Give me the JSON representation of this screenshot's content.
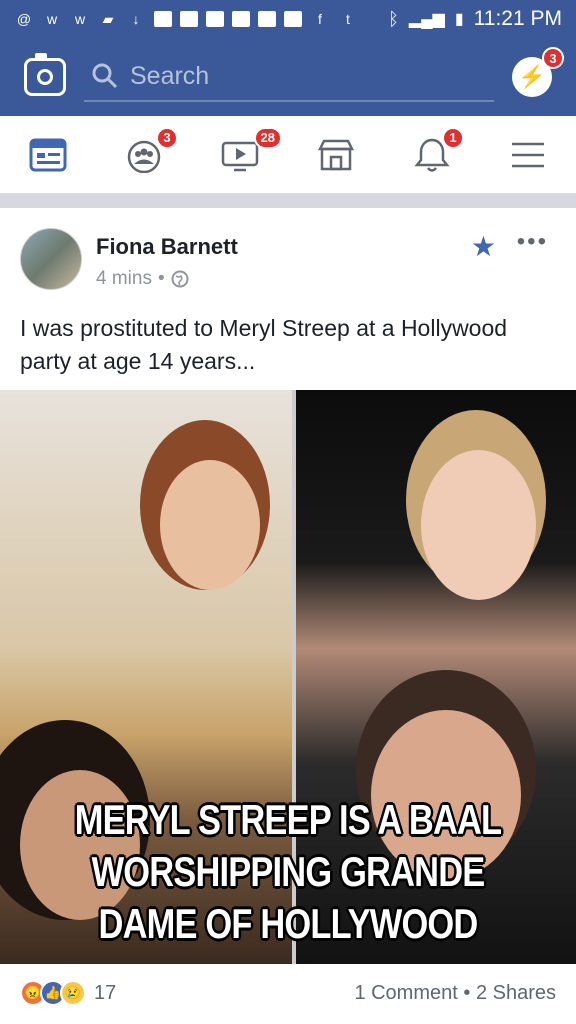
{
  "status": {
    "time": "11:21 PM"
  },
  "search": {
    "placeholder": "Search"
  },
  "badges": {
    "messenger": "3",
    "friends": "3",
    "video": "28",
    "notifications": "1"
  },
  "post": {
    "author": "Fiona Barnett",
    "time": "4 mins",
    "text": "I was prostituted to Meryl Streep at a Hollywood party at age 14 years...",
    "image_caption": [
      "MERYL STREEP IS A BAAL",
      "WORSHIPPING GRANDE",
      "DAME OF HOLLYWOOD"
    ],
    "reaction_count": "17",
    "comments": "1 Comment",
    "shares": "2 Shares"
  },
  "colors": {
    "brand": "#3b5998",
    "badge": "#e02f2f",
    "star": "#4267b2"
  },
  "icons": [
    "camera-icon",
    "search-icon",
    "messenger-icon",
    "news-feed-icon",
    "friends-icon",
    "video-icon",
    "marketplace-icon",
    "notifications-icon",
    "menu-icon",
    "globe-icon",
    "star-icon",
    "more-icon"
  ]
}
